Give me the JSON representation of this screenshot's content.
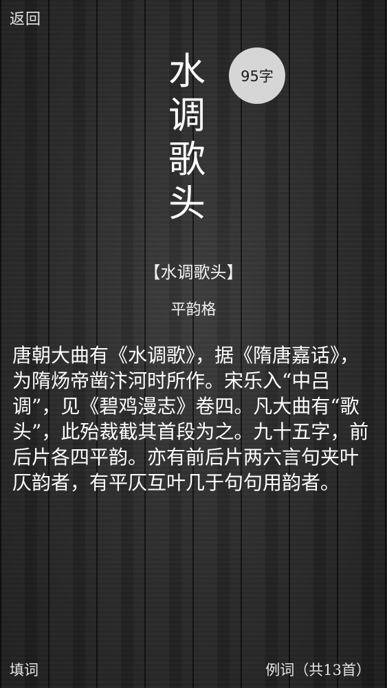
{
  "nav": {
    "back_label": "返回"
  },
  "header": {
    "title_chars": [
      "水",
      "调",
      "歌",
      "头"
    ],
    "word_count_badge": "95字"
  },
  "body": {
    "subtitle": "【水调歌头】",
    "rhyme_type": "平韵格",
    "description": "唐朝大曲有《水调歌》，据《隋唐嘉话》，为隋炀帝凿汴河时所作。宋乐入“中吕调”，见《碧鸡漫志》卷四。凡大曲有“歌头”，此殆裁截其首段为之。九十五字，前后片各四平韵。亦有前后片两六言句夹叶仄韵者，有平仄互叶几于句句用韵者。"
  },
  "footer": {
    "fill_words_label": "填词",
    "examples_label": "例词（共13首）"
  }
}
